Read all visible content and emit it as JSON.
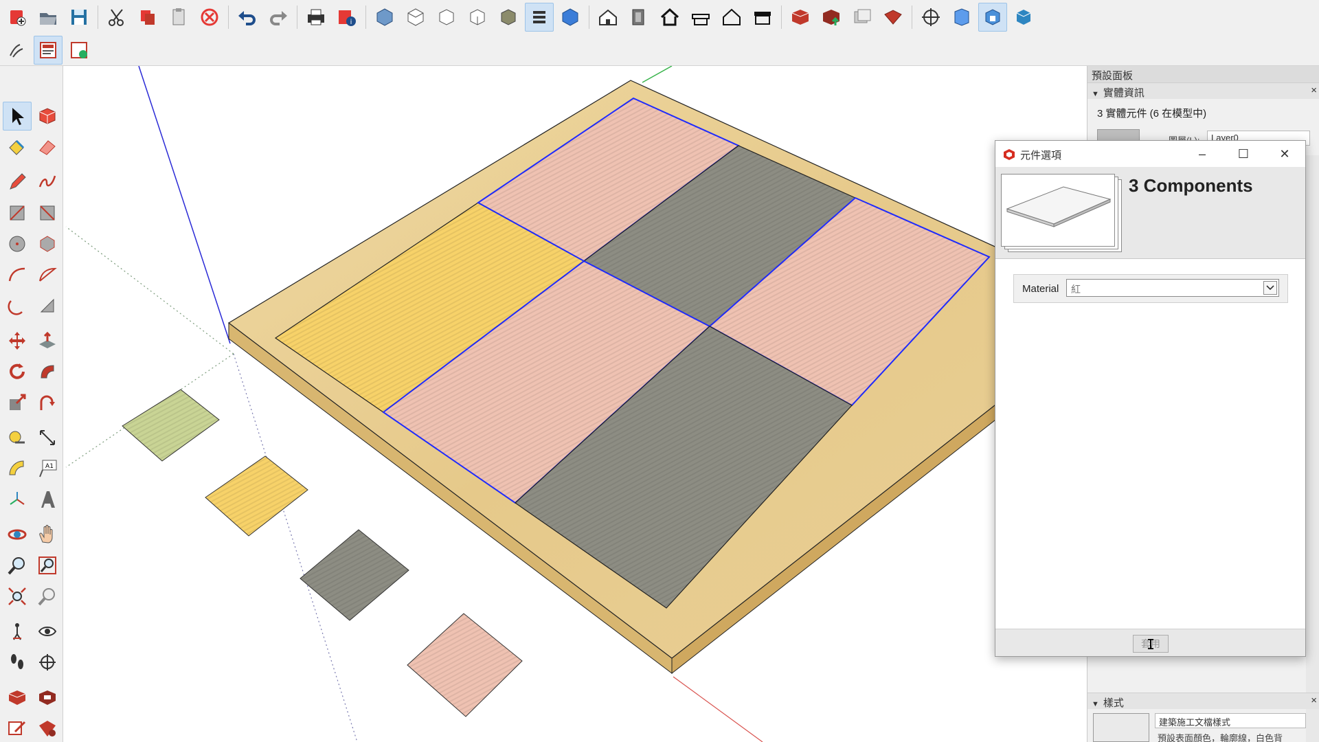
{
  "tray": {
    "title": "預設面板",
    "entity_info": {
      "section_label": "實體資訊",
      "summary": "3 實體元件 (6 在模型中)",
      "layer_label": "圖層(L):",
      "layer_value": "Layer0"
    },
    "styles": {
      "section_label": "樣式",
      "style_name": "建築施工文檔樣式",
      "style_desc": "預設表面顏色，輪廓線，白色背"
    }
  },
  "dialog": {
    "title": "元件選項",
    "header": "3 Components",
    "material_label": "Material",
    "material_value": "紅",
    "apply_label": "套用"
  },
  "colors": {
    "tatami_pink": "#efc2b2",
    "tatami_yellow": "#f7d269",
    "tatami_gray": "#8d8d83",
    "tatami_green": "#c9d495",
    "wood": "#e8cf93",
    "selection_blue": "#1f2bff"
  },
  "icons": {
    "top_row1": [
      "new-model-icon",
      "open-icon",
      "save-icon",
      "cut-icon",
      "copy-icon",
      "paste-icon",
      "erase-icon",
      "undo-icon",
      "redo-icon",
      "print-icon",
      "model-info-icon",
      "iso-view-icon",
      "top-view-icon",
      "front-view-icon",
      "right-view-icon",
      "back-view-icon",
      "left-view-icon",
      "bottom-view-icon",
      "xray-icon",
      "warehouse-icon",
      "door-icon",
      "house-icon",
      "roof-icon",
      "house-outline-icon",
      "garage-icon",
      "extension-warehouse-icon",
      "upload-icon",
      "share-icon",
      "ruby-icon",
      "section-plane-icon",
      "section-cut-icon",
      "section-display-icon",
      "solid-box-icon"
    ],
    "top_row2": [
      "sandbox-icon",
      "component-options-icon",
      "component-attributes-icon"
    ],
    "left_tools": [
      "select-icon",
      "make-component-icon",
      "paint-bucket-icon",
      "eraser-icon",
      "pencil-icon",
      "freehand-icon",
      "rectangle-icon",
      "rotated-rectangle-icon",
      "circle-icon",
      "polygon-icon",
      "arc-icon",
      "two-point-arc-icon",
      "pie-icon",
      "three-point-arc-icon",
      "move-icon",
      "push-pull-icon",
      "rotate-icon",
      "follow-me-icon",
      "scale-icon",
      "offset-icon",
      "tape-measure-icon",
      "dimension-icon",
      "protractor-icon",
      "text-icon",
      "axes-icon",
      "3d-text-icon",
      "orbit-icon",
      "pan-icon",
      "zoom-icon",
      "zoom-window-icon",
      "zoom-extents-icon",
      "previous-view-icon",
      "position-camera-icon",
      "look-around-icon",
      "walk-icon",
      "section-plane-tool-icon",
      "warehouse-left-icon",
      "extension-left-icon",
      "send-to-layout-icon",
      "ruby-left-icon"
    ]
  }
}
